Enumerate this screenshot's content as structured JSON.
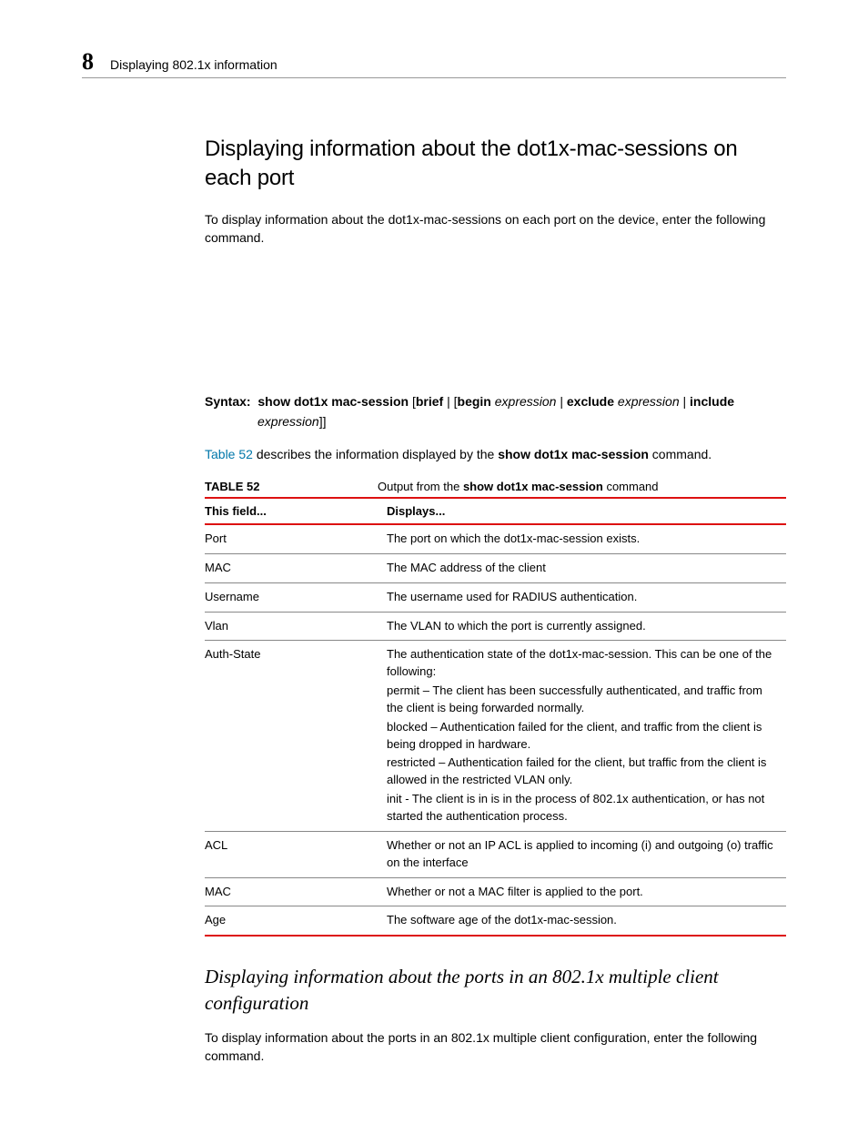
{
  "header": {
    "chapter_number": "8",
    "running_title": "Displaying 802.1x information"
  },
  "section_title": "Displaying information about the dot1x-mac-sessions on each port",
  "intro_para": "To display information about the dot1x-mac-sessions on each port on the device, enter the following command.",
  "syntax": {
    "label": "Syntax:",
    "pre_cmd": "show dot1x mac-session",
    "bracket_open": " [",
    "kw_brief": "brief",
    "pipe1": " | [",
    "kw_begin": "begin",
    "arg1": " expression",
    "pipe2": " | ",
    "kw_exclude": "exclude",
    "arg2": " expression",
    "pipe3": " | ",
    "kw_include": "include",
    "arg3_line2": "expression",
    "close": "]]"
  },
  "table_ref_sentence_pre": " describes the information displayed by the ",
  "table_ref_link": "Table 52",
  "table_ref_cmd": "show dot1x mac-session",
  "table_ref_sentence_post": " command.",
  "table_caption": {
    "label": "TABLE 52",
    "pre": "Output from the ",
    "cmd": "show dot1x mac-session",
    "post": " command"
  },
  "table": {
    "head_field": "This field...",
    "head_displays": "Displays...",
    "rows": [
      {
        "field": "Port",
        "desc": [
          "The port on which the dot1x-mac-session exists."
        ]
      },
      {
        "field": "MAC",
        "desc": [
          "The MAC address of the client"
        ]
      },
      {
        "field": "Username",
        "desc": [
          "The username used for RADIUS authentication."
        ]
      },
      {
        "field": "Vlan",
        "desc": [
          "The VLAN to which the port is currently assigned."
        ]
      },
      {
        "field": "Auth-State",
        "desc": [
          "The authentication state of the dot1x-mac-session.  This can be one of the following:",
          "permit – The client has been successfully authenticated, and traffic from the client is being forwarded normally.",
          "blocked – Authentication failed for the client, and traffic from the client is being dropped in hardware.",
          "restricted – Authentication failed for the client, but traffic from the client is allowed in the restricted VLAN only.",
          "init - The client is in is in the process of 802.1x authentication, or has not started the authentication process."
        ]
      },
      {
        "field": "ACL",
        "desc": [
          "Whether or not an IP ACL is applied to incoming (i) and outgoing (o) traffic on the interface"
        ]
      },
      {
        "field": "MAC",
        "desc": [
          "Whether or not a MAC filter is applied to the port."
        ]
      },
      {
        "field": "Age",
        "desc": [
          "The software age of the dot1x-mac-session."
        ]
      }
    ]
  },
  "subsection_title": "Displaying information about the ports in an 802.1x multiple client configuration",
  "subsection_para": "To display information about the ports in an 802.1x multiple client configuration, enter the following command."
}
